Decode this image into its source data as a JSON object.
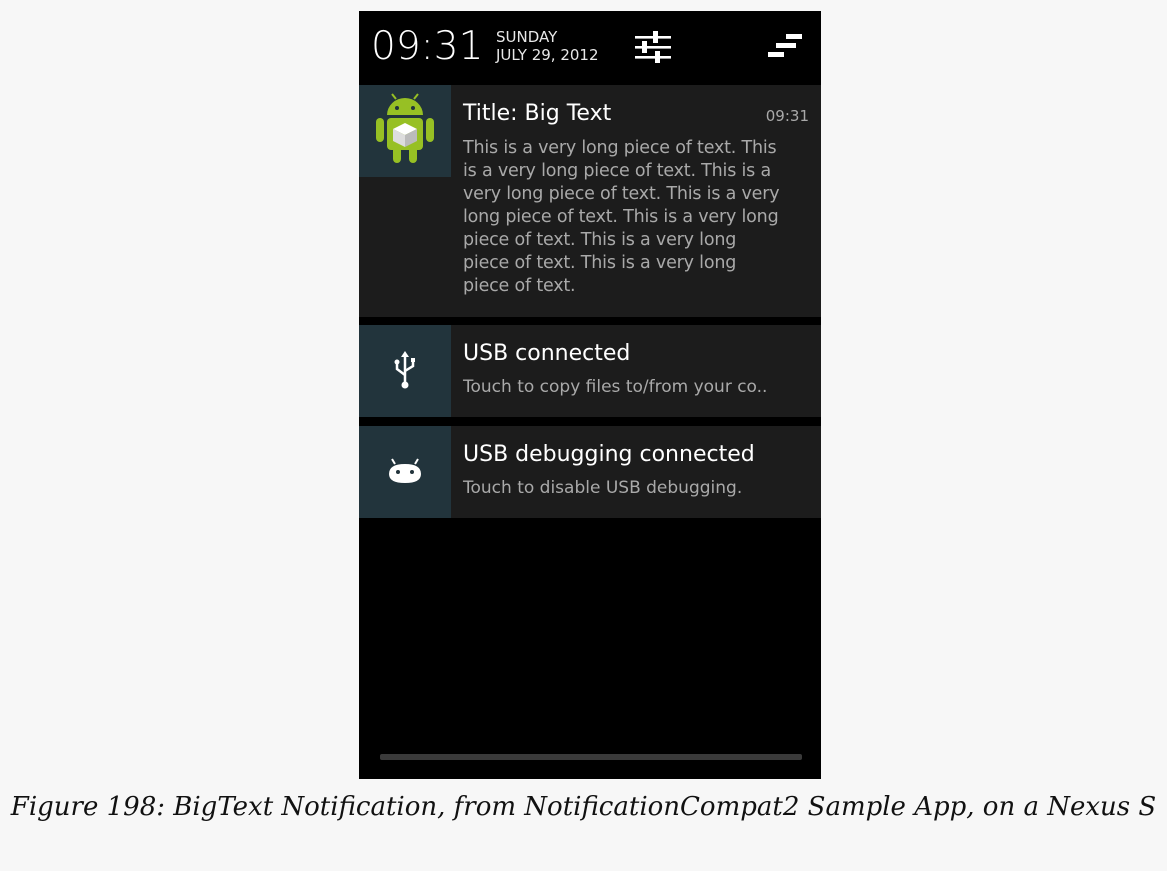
{
  "status_bar": {
    "time": "09:31",
    "day": "SUNDAY",
    "date": "JULY 29, 2012",
    "settings_icon": "quick-settings-sliders-icon",
    "clear_icon": "clear-all-notifications-icon"
  },
  "notifications": [
    {
      "icon": "android-robot-icon",
      "title": "Title: Big Text",
      "time": "09:31",
      "text": "This is a very long piece of text. This\nis a very long piece of text. This is a\nvery long piece of text. This is a very\nlong piece of text. This is a very long\npiece of text. This is a very long\npiece of text. This is a very long\npiece of text."
    },
    {
      "icon": "usb-icon",
      "title": "USB connected",
      "text": "Touch to copy files to/from your co.."
    },
    {
      "icon": "android-debug-icon",
      "title": "USB debugging connected",
      "text": "Touch to disable USB debugging."
    }
  ],
  "caption": "Figure 198: BigText Notification, from NotificationCompat2 Sample App, on a Nexus S",
  "colors": {
    "screen_background": "#000000",
    "notification_background": "#1c1c1c",
    "icon_background": "#22343c",
    "page_background": "#f7f7f7"
  }
}
